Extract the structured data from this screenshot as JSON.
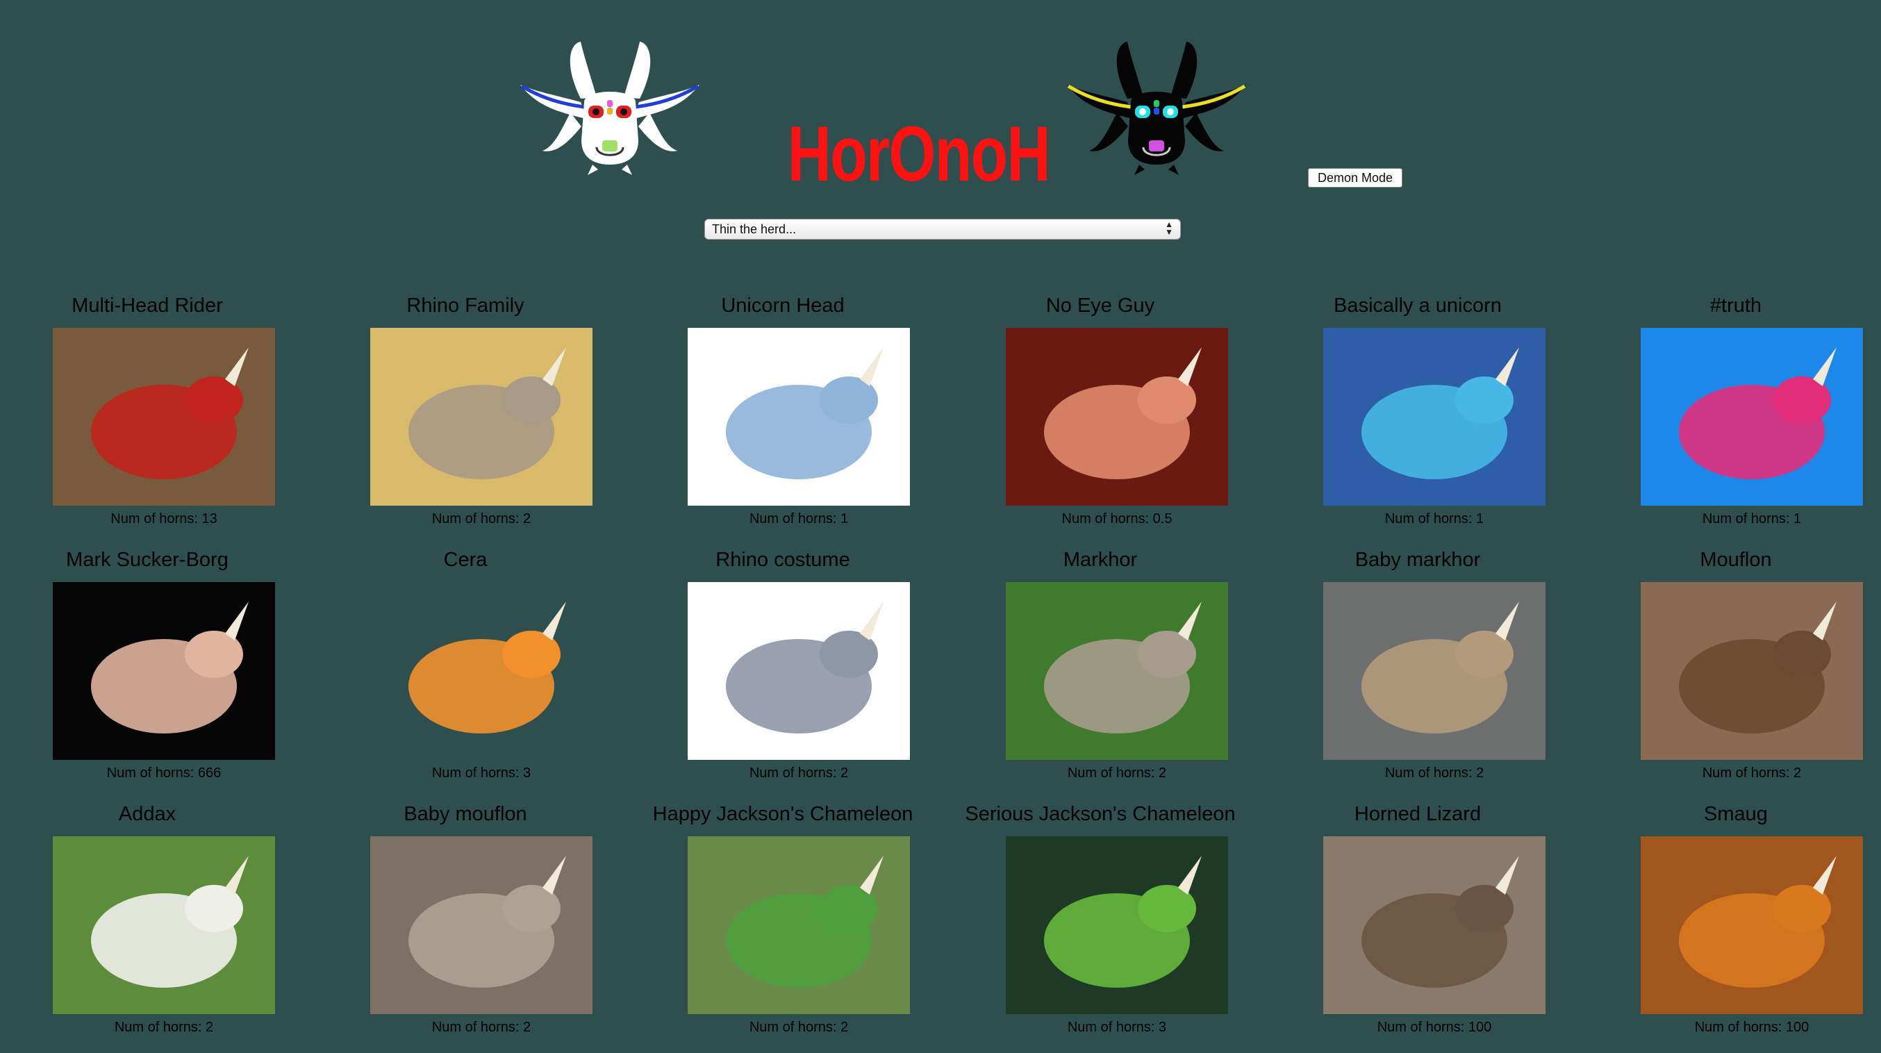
{
  "header": {
    "logo_text": "HorOnoH",
    "demon_button_label": "Demon Mode",
    "mascot_white_icon": "white-horned-creature-icon",
    "mascot_black_icon": "black-horned-creature-icon",
    "title_color": "#ff1111",
    "background_color": "#2f4f4f"
  },
  "filter": {
    "selected_label": "Thin the herd..."
  },
  "cards": [
    {
      "name": "Multi-Head Rider",
      "horns": "Num of horns: 13",
      "bg": "#7a5a3c",
      "fg": "#c0241c"
    },
    {
      "name": "Rhino Family",
      "horns": "Num of horns: 2",
      "bg": "#d9b96a",
      "fg": "#a89a86"
    },
    {
      "name": "Unicorn Head",
      "horns": "Num of horns: 1",
      "bg": "#ffffff",
      "fg": "#8fb3d9"
    },
    {
      "name": "No Eye Guy",
      "horns": "Num of horns: 0.5",
      "bg": "#6b1a12",
      "fg": "#e08a6e"
    },
    {
      "name": "Basically a unicorn",
      "horns": "Num of horns: 1",
      "bg": "#2e5ea8",
      "fg": "#46b7e6"
    },
    {
      "name": "#truth",
      "horns": "Num of horns: 1",
      "bg": "#1e88e8",
      "fg": "#e22d7a"
    },
    {
      "name": "Mark Sucker-Borg",
      "horns": "Num of horns: 666",
      "bg": "#050505",
      "fg": "#e1b4a0"
    },
    {
      "name": "Cera",
      "horns": "Num of horns: 3",
      "bg": "#2f4f4f",
      "fg": "#f2902e"
    },
    {
      "name": "Rhino costume",
      "horns": "Num of horns: 2",
      "bg": "#ffffff",
      "fg": "#8f96a6"
    },
    {
      "name": "Markhor",
      "horns": "Num of horns: 2",
      "bg": "#3f7a2e",
      "fg": "#a59c8c"
    },
    {
      "name": "Baby markhor",
      "horns": "Num of horns: 2",
      "bg": "#6d6e6e",
      "fg": "#b29a7b"
    },
    {
      "name": "Mouflon",
      "horns": "Num of horns: 2",
      "bg": "#8a6a55",
      "fg": "#6a4a32"
    },
    {
      "name": "Addax",
      "horns": "Num of horns: 2",
      "bg": "#5d8c3b",
      "fg": "#efefea"
    },
    {
      "name": "Baby mouflon",
      "horns": "Num of horns: 2",
      "bg": "#7d7064",
      "fg": "#b0a292"
    },
    {
      "name": "Happy Jackson's Chameleon",
      "horns": "Num of horns: 2",
      "bg": "#6a8a4a",
      "fg": "#4f9d3c"
    },
    {
      "name": "Serious Jackson's Chameleon",
      "horns": "Num of horns: 3",
      "bg": "#1f3a24",
      "fg": "#66b83c"
    },
    {
      "name": "Horned Lizard",
      "horns": "Num of horns: 100",
      "bg": "#8a7a6c",
      "fg": "#6a5443"
    },
    {
      "name": "Smaug",
      "horns": "Num of horns: 100",
      "bg": "#a0561c",
      "fg": "#d9781f"
    }
  ]
}
